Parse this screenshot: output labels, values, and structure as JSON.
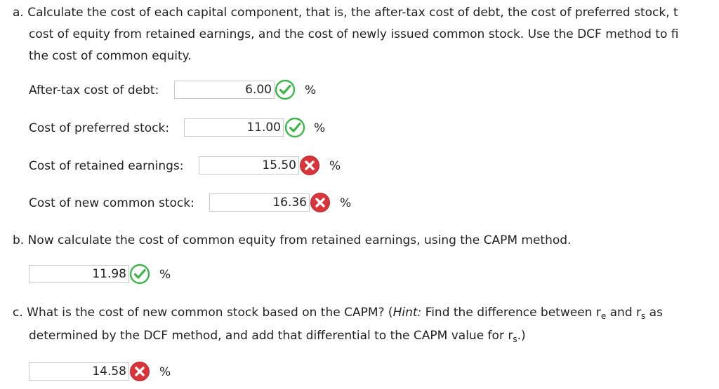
{
  "part_a": {
    "line1": "a. Calculate the cost of each capital component, that is, the after-tax cost of debt, the cost of preferred stock, t",
    "line2": "cost of equity from retained earnings, and the cost of newly issued common stock. Use the DCF method to fi",
    "line3": "the cost of common equity.",
    "fields": [
      {
        "label": "After-tax cost of debt:",
        "value": "6.00",
        "status": "correct",
        "unit": "%"
      },
      {
        "label": "Cost of preferred stock:",
        "value": "11.00",
        "status": "correct",
        "unit": "%"
      },
      {
        "label": "Cost of retained earnings:",
        "value": "15.50",
        "status": "incorrect",
        "unit": "%"
      },
      {
        "label": "Cost of new common stock:",
        "value": "16.36",
        "status": "incorrect",
        "unit": "%"
      }
    ]
  },
  "part_b": {
    "question": "b. Now calculate the cost of common equity from retained earnings, using the CAPM method.",
    "value": "11.98",
    "status": "correct",
    "unit": "%"
  },
  "part_c": {
    "line1_prefix": "c. What is the cost of new common stock based on the CAPM? (",
    "hint_label": "Hint:",
    "line1_mid": " Find the difference between r",
    "sub_e": "e",
    "line1_and": " and r",
    "sub_s": "s",
    "line1_suffix": " as",
    "line2_prefix": "determined by the DCF method, and add that differential to the CAPM value for r",
    "line2_sub": "s",
    "line2_suffix": ".)",
    "value": "14.58",
    "status": "incorrect",
    "unit": "%"
  },
  "colors": {
    "correct": "#3cb54a",
    "incorrect": "#d9343a"
  },
  "icons": {
    "correct": "check-circle-icon",
    "incorrect": "x-circle-icon"
  }
}
